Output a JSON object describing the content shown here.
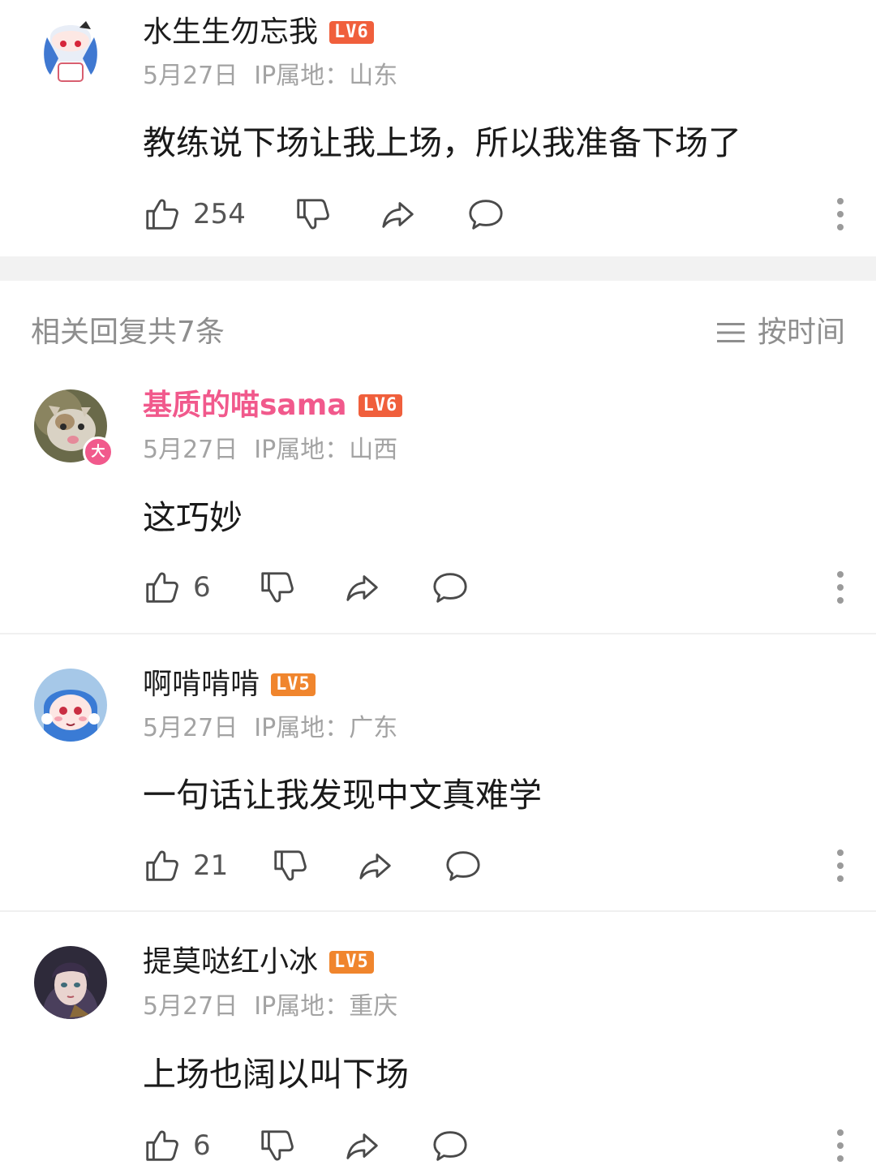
{
  "main_comment": {
    "username": "水生生勿忘我",
    "level": "LV6",
    "date": "5月27日",
    "ip": "IP属地：山东",
    "content": "教练说下场让我上场，所以我准备下场了",
    "likes": "254"
  },
  "replies_header": {
    "title": "相关回复共7条",
    "sort_label": "按时间"
  },
  "replies": [
    {
      "username": "基质的喵sama",
      "level": "LV6",
      "date": "5月27日",
      "ip": "IP属地：山西",
      "content": "这巧妙",
      "likes": "6",
      "badge": "大"
    },
    {
      "username": "啊啃啃啃",
      "level": "LV5",
      "date": "5月27日",
      "ip": "IP属地：广东",
      "content": "一句话让我发现中文真难学",
      "likes": "21"
    },
    {
      "username": "提莫哒红小冰",
      "level": "LV5",
      "date": "5月27日",
      "ip": "IP属地：重庆",
      "content": "上场也阔以叫下场",
      "likes": "6"
    }
  ],
  "colors": {
    "accent_pink": "#f1598c",
    "lv6": "#f05f3c",
    "lv5": "#f0852d",
    "meta_gray": "#a3a3a3"
  },
  "icons": [
    "thumbs-up-icon",
    "thumbs-down-icon",
    "share-icon",
    "comment-icon",
    "more-vertical-icon",
    "sort-lines-icon"
  ]
}
